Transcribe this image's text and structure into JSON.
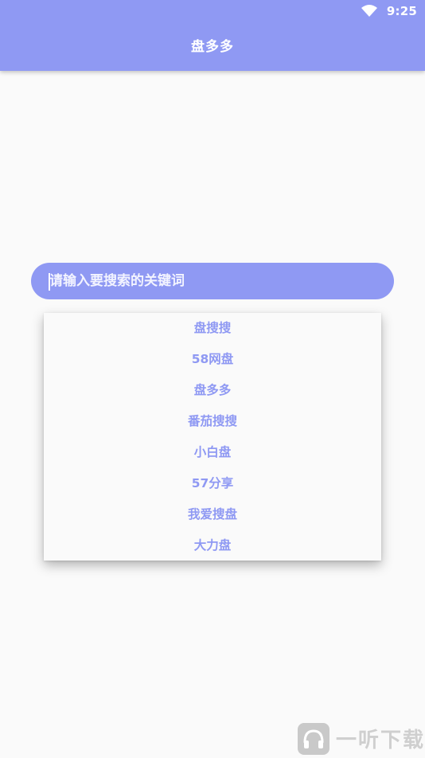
{
  "status_bar": {
    "time": "9:25",
    "wifi_icon": "wifi-icon"
  },
  "app_bar": {
    "title": "盘多多",
    "background_color": "#8f99f3"
  },
  "search": {
    "placeholder": "请输入要搜索的关键词",
    "value": ""
  },
  "dropdown": {
    "items": [
      {
        "label": "盘搜搜"
      },
      {
        "label": "58网盘"
      },
      {
        "label": "盘多多"
      },
      {
        "label": "番茄搜搜"
      },
      {
        "label": "小白盘"
      },
      {
        "label": "57分享"
      },
      {
        "label": "我爱搜盘"
      },
      {
        "label": "大力盘"
      }
    ],
    "text_color": "#8f99f3"
  },
  "watermark": {
    "text": "一听下载",
    "logo_icon": "headphone-logo-icon"
  }
}
